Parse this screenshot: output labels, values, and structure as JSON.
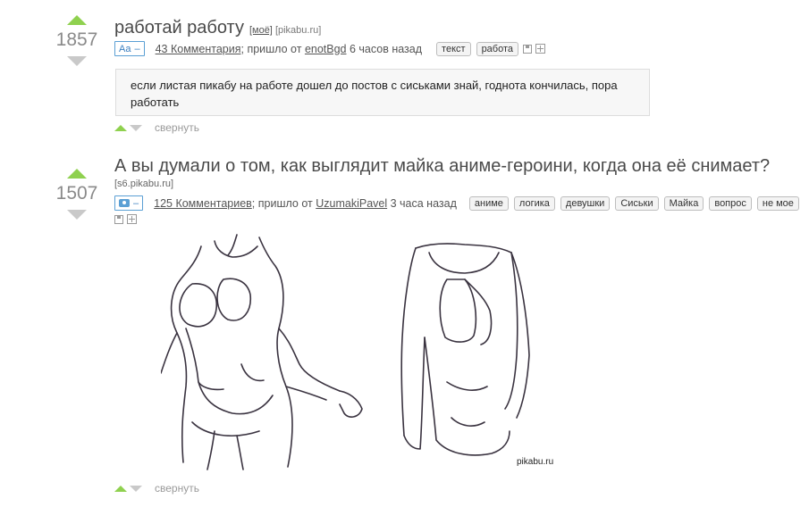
{
  "posts": [
    {
      "rating": "1857",
      "title": "работай работу",
      "source_mine": "[моё]",
      "source_domain": "[pikabu.ru]",
      "type_label": "Aa",
      "type_dash": "–",
      "comments": "43 Комментария",
      "from_text": "; пришло от",
      "author": "enotBgd",
      "time": "6 часов назад",
      "tags": [
        "текст",
        "работа"
      ],
      "text": "если листая пикабу на работе дошел до постов с сиськами знай, годнота кончилась, пора работать",
      "collapse": "свернуть"
    },
    {
      "rating": "1507",
      "title": "А вы думали о том, как выглядит майка аниме-героини, когда она её снимает?",
      "source_domain": "[s6.pikabu.ru]",
      "type_dash": "–",
      "comments": "125 Комментариев",
      "from_text": "; пришло от",
      "author": "UzumakiPavel",
      "time": "3 часа назад",
      "tags": [
        "аниме",
        "логика",
        "девушки",
        "Сиськи",
        "Майка",
        "вопрос",
        "не мое"
      ],
      "image_watermark": "pikabu.ru",
      "collapse": "свернуть"
    }
  ],
  "colors": {
    "upvote": "#8fd14f",
    "downvote": "#c9c9c9",
    "badge": "#5a9fd4"
  }
}
